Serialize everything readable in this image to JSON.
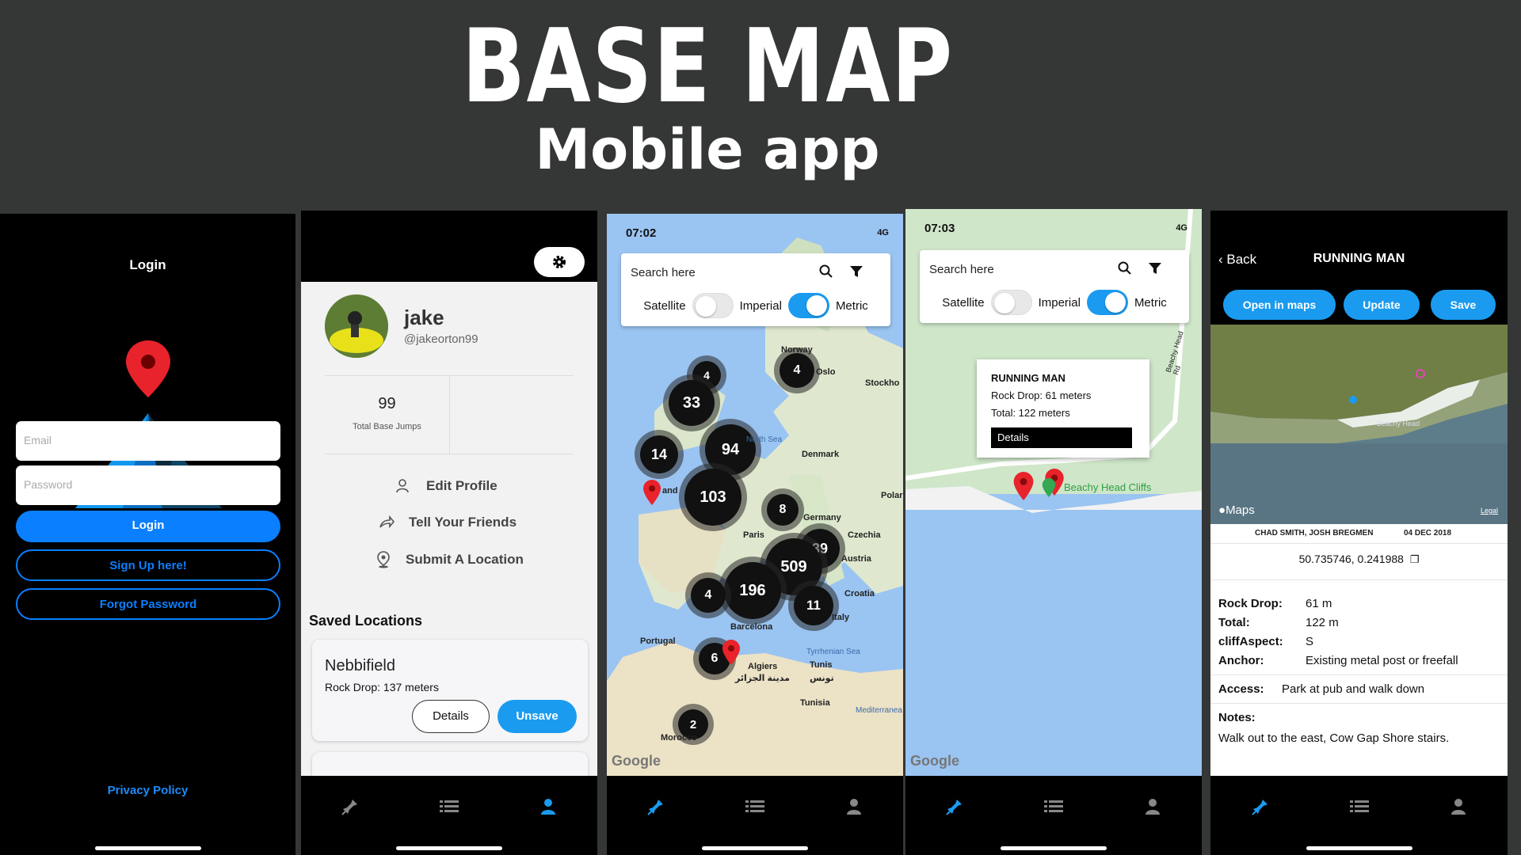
{
  "header": {
    "title": "BASE MAP",
    "subtitle": "Mobile app"
  },
  "login": {
    "title": "Login",
    "email_placeholder": "Email",
    "password_placeholder": "Password",
    "login_button": "Login",
    "signup_button": "Sign Up here!",
    "forgot_button": "Forgot Password",
    "privacy_link": "Privacy Policy"
  },
  "profile": {
    "username": "jake",
    "handle": "@jakeorton99",
    "stat_value": "99",
    "stat_label": "Total Base Jumps",
    "actions": [
      "Edit Profile",
      "Tell Your Friends",
      "Submit A Location"
    ],
    "saved_title": "Saved Locations",
    "saved": [
      {
        "name": "Nebbifield",
        "detail": "Rock Drop: 137 meters",
        "details_btn": "Details",
        "unsave_btn": "Unsave"
      }
    ]
  },
  "map_common": {
    "search_placeholder": "Search here",
    "satellite": "Satellite",
    "imperial": "Imperial",
    "metric": "Metric",
    "network": "4G",
    "google": "Google"
  },
  "map_europe": {
    "time": "07:02",
    "clusters": [
      "4",
      "33",
      "94",
      "14",
      "103",
      "4",
      "8",
      "39",
      "509",
      "196",
      "4",
      "11",
      "6",
      "2"
    ],
    "labels": [
      "Norway",
      "Oslo",
      "Stockho",
      "North Sea",
      "Denmark",
      "Polar",
      "Germany",
      "Czechia",
      "Austria",
      "Paris",
      "Croatia",
      "Italy",
      "Barcelona",
      "Portugal",
      "Algiers",
      "مدينة الجزائر",
      "Tunis",
      "تونس",
      "Tunisia",
      "Morocco",
      "Tyrrhenian Sea",
      "Mediterranea",
      "and"
    ]
  },
  "map_cliff": {
    "time": "07:03",
    "road_label": "Beachy Head Rd",
    "place_label": "Beachy Head Cliffs",
    "popup": {
      "title": "RUNNING MAN",
      "rock_drop": "Rock Drop: 61 meters",
      "total": "Total: 122 meters",
      "button": "Details"
    }
  },
  "detail": {
    "back": "Back",
    "title": "RUNNING MAN",
    "buttons": [
      "Open in maps",
      "Update",
      "Save"
    ],
    "maps_logo": "Maps",
    "legal": "Legal",
    "map_label": "Beachy Head",
    "credit": "CHAD SMITH, JOSH BREGMEN",
    "date": "04 DEC 2018",
    "coords": "50.735746, 0.241988",
    "fields": [
      {
        "k": "Rock Drop:",
        "v": "61 m"
      },
      {
        "k": "Total:",
        "v": "122 m"
      },
      {
        "k": "cliffAspect:",
        "v": "S"
      },
      {
        "k": "Anchor:",
        "v": "Existing metal post or freefall"
      }
    ],
    "access_k": "Access:",
    "access_v": "Park at pub and walk down",
    "notes_k": "Notes:",
    "notes_v": "Walk out to the east, Cow Gap Shore stairs."
  },
  "colors": {
    "accent": "#1a9bf0",
    "primary_blue": "#0a7fff",
    "background": "#353636",
    "pin": "#e8232b"
  }
}
